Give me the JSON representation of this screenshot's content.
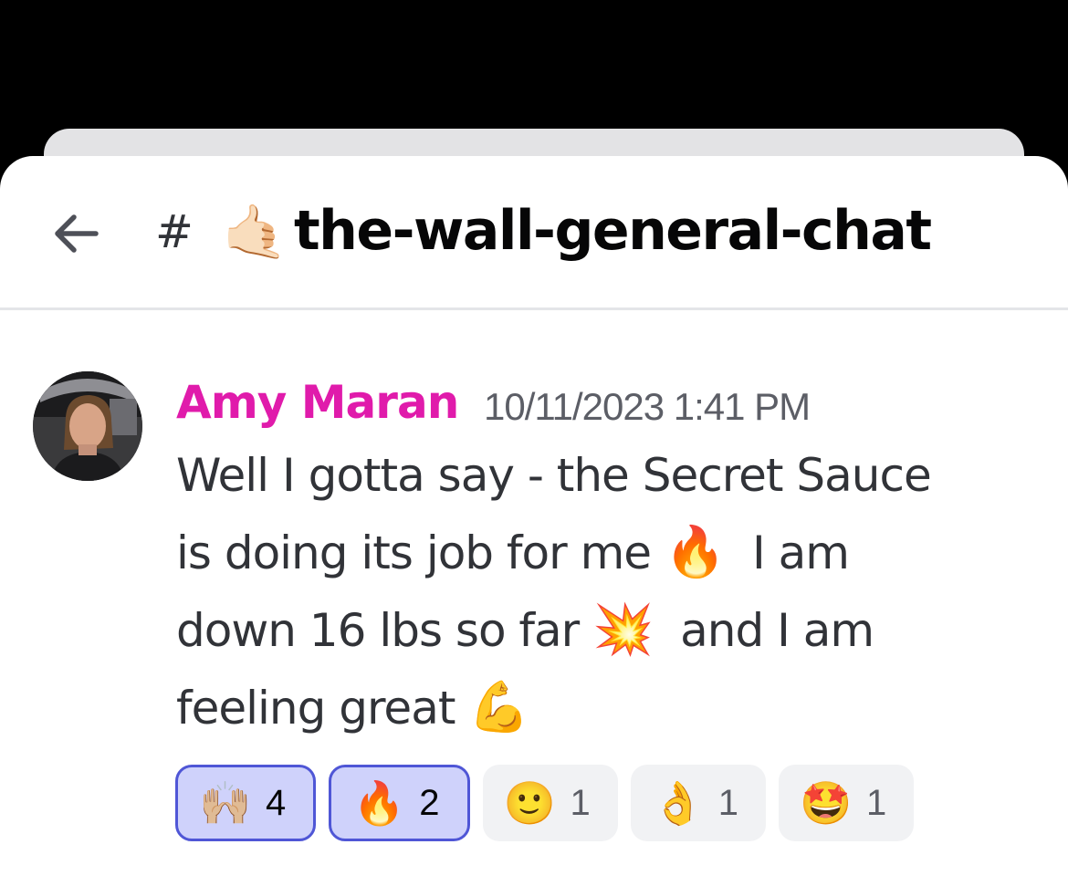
{
  "channel": {
    "hash": "#",
    "emoji": "🤙🏻",
    "name": "the-wall-general-chat"
  },
  "message": {
    "author": "Amy Maran",
    "author_color": "#e01bab",
    "timestamp": "10/11/2023 1:41 PM",
    "content": {
      "line1": "Well I gotta say - the Secret Sauce",
      "line2_text": "is doing its job for me ",
      "line2_emoji": "🔥",
      "line2_after": "  I am",
      "line3_text": "down 16 lbs so far ",
      "line3_emoji": "💥",
      "line3_after": "  and I am",
      "line4_text": "feeling great ",
      "line4_emoji": "💪"
    },
    "reactions": [
      {
        "emoji": "🙌🏼",
        "count": "4",
        "me": true
      },
      {
        "emoji": "🔥",
        "count": "2",
        "me": true
      },
      {
        "emoji": "🙂",
        "count": "1",
        "me": false
      },
      {
        "emoji": "👌",
        "count": "1",
        "me": false
      },
      {
        "emoji": "🤩",
        "count": "1",
        "me": false
      }
    ]
  },
  "colors": {
    "background": "#000000",
    "sheet": "#ffffff",
    "reaction_selected_bg": "#cfd2fb",
    "reaction_selected_border": "#4f56d6",
    "reaction_bg": "#f1f2f4"
  },
  "icons": {
    "back": "arrow-left-icon",
    "avatar": "user-avatar-photo"
  }
}
